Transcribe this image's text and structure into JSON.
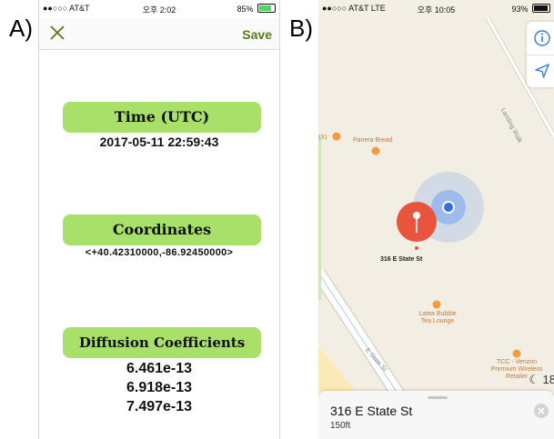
{
  "panel_labels": {
    "a": "A)",
    "b": "B)"
  },
  "phone_a": {
    "status": {
      "carrier": "●●○○○ AT&T",
      "time": "오후 2:02",
      "battery": "85%"
    },
    "nav": {
      "save_label": "Save"
    },
    "sections": [
      {
        "title": "Time (UTC)",
        "values": [
          "2017-05-11 22:59:43"
        ]
      },
      {
        "title": "Coordinates",
        "values": [
          "<+40.42310000,-86.92450000>"
        ]
      },
      {
        "title": "Diffusion Coefficients",
        "values": [
          "6.461e-13",
          "6.918e-13",
          "7.497e-13"
        ]
      }
    ],
    "colors": {
      "accent_pill": "#a9e06a",
      "save": "#5a7a1a"
    }
  },
  "phone_b": {
    "status": {
      "carrier": "●●○○○ AT&T  LTE",
      "time": "오후 10:05",
      "battery": "93%"
    },
    "map": {
      "pin_label": "316 E State St",
      "pois": {
        "panera": "Panera Bread",
        "latea": "Latea Bubble Tea Lounge",
        "tcc": "TCC - Verizon Premium Wireless Retailer",
        "left_cut": "(X)"
      },
      "streets": {
        "lansing": "Landing Walk",
        "state": "E State St"
      },
      "temperature": "☾ 18"
    },
    "sheet": {
      "title": "316 E State St",
      "distance": "150ft"
    },
    "colors": {
      "pin": "#e9543d",
      "location": "#3b82f6"
    }
  }
}
